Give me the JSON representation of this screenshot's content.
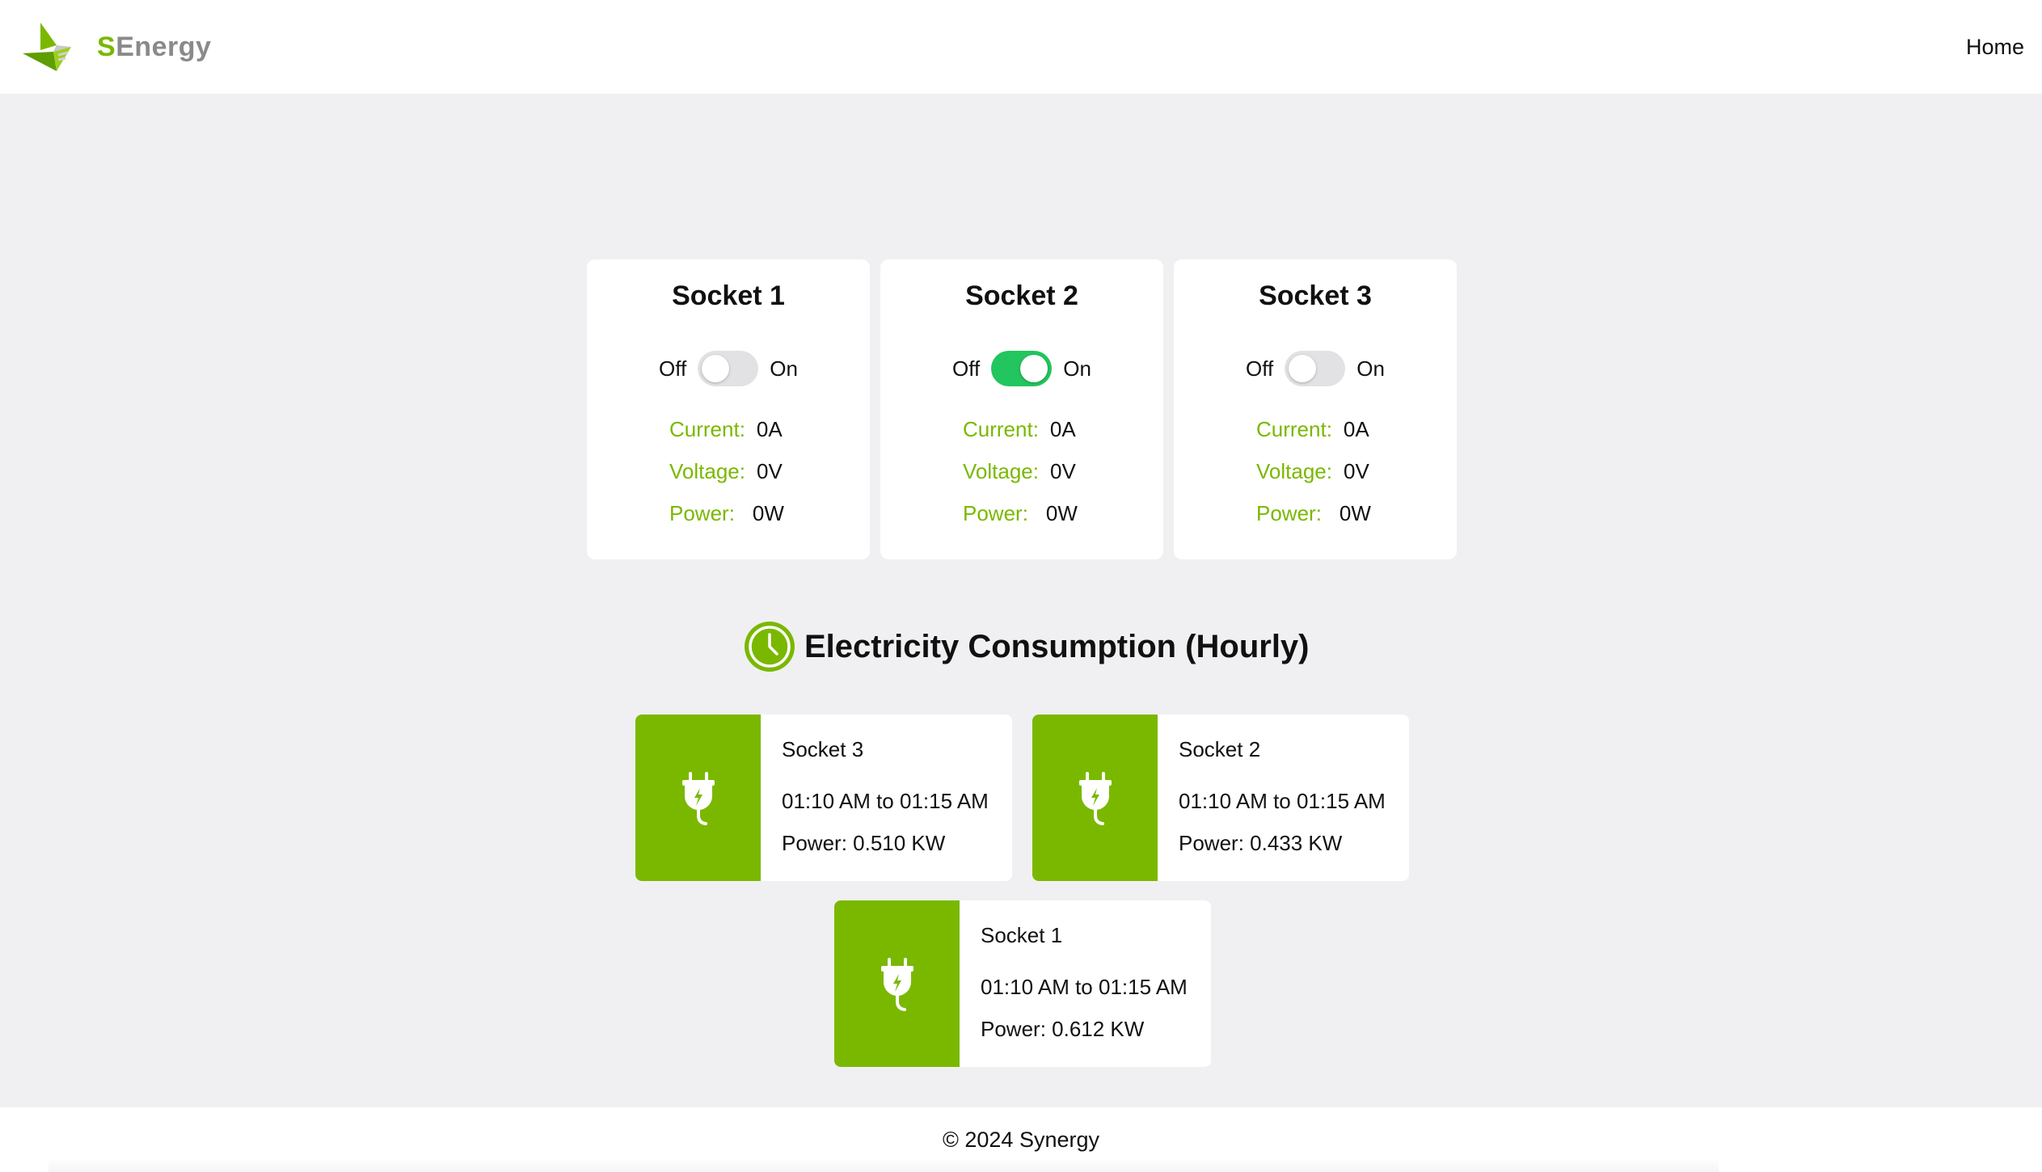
{
  "brand": {
    "first_letter": "S",
    "rest": "Energy",
    "logo_icon": "senergy-logo-icon"
  },
  "nav": {
    "home": "Home"
  },
  "sockets": [
    {
      "title": "Socket 1",
      "off_label": "Off",
      "on_label": "On",
      "is_on": false,
      "current_label": "Current:",
      "current": "0A",
      "voltage_label": "Voltage:",
      "voltage": "0V",
      "power_label": "Power:",
      "power": "0W"
    },
    {
      "title": "Socket 2",
      "off_label": "Off",
      "on_label": "On",
      "is_on": true,
      "current_label": "Current:",
      "current": "0A",
      "voltage_label": "Voltage:",
      "voltage": "0V",
      "power_label": "Power:",
      "power": "0W"
    },
    {
      "title": "Socket 3",
      "off_label": "Off",
      "on_label": "On",
      "is_on": false,
      "current_label": "Current:",
      "current": "0A",
      "voltage_label": "Voltage:",
      "voltage": "0V",
      "power_label": "Power:",
      "power": "0W"
    }
  ],
  "consumption": {
    "title": "Electricity Consumption (Hourly)",
    "icon": "clock-icon",
    "entries": [
      {
        "name": "Socket 3",
        "time": "01:10 AM to 01:15 AM",
        "power": "Power: 0.510 KW",
        "icon": "plug-icon"
      },
      {
        "name": "Socket 2",
        "time": "01:10 AM to 01:15 AM",
        "power": "Power: 0.433 KW",
        "icon": "plug-icon"
      },
      {
        "name": "Socket 1",
        "time": "01:10 AM to 01:15 AM",
        "power": "Power: 0.612 KW",
        "icon": "plug-icon"
      }
    ]
  },
  "footer": {
    "text": "© 2024 Synergy"
  },
  "colors": {
    "accent": "#7ab800",
    "switch_on": "#22c55e",
    "switch_off": "#e2e2e4",
    "background": "#f0f0f2"
  }
}
